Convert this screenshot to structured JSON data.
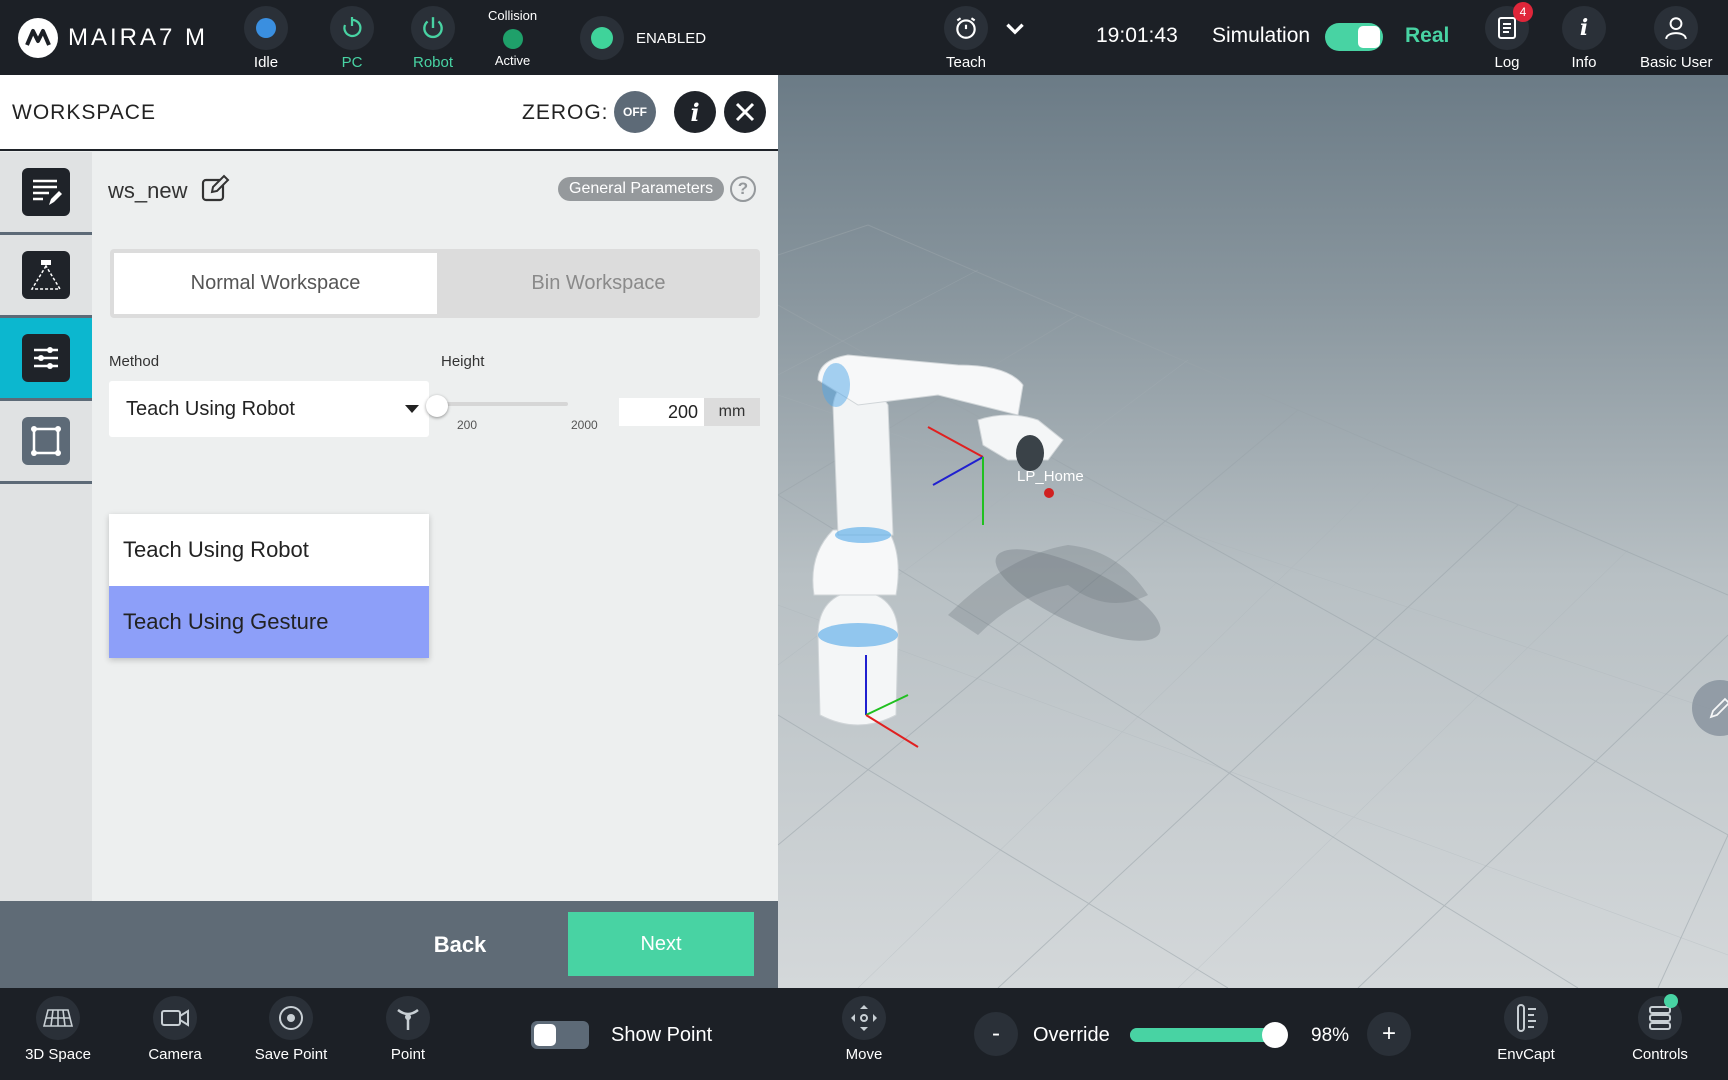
{
  "topbar": {
    "logo": "MAIRA7 M",
    "state_idle": "Idle",
    "state_pc": "PC",
    "state_robot": "Robot",
    "collision_title": "Collision",
    "collision_state": "Active",
    "enabled": "ENABLED",
    "teach": "Teach",
    "time": "19:01:43",
    "simulation": "Simulation",
    "real": "Real",
    "log": "Log",
    "log_badge": "4",
    "info": "Info",
    "user": "Basic User"
  },
  "panel": {
    "title": "WORKSPACE",
    "zerog": "ZEROG:",
    "zerog_state": "OFF",
    "ws_name": "ws_new",
    "general_params": "General Parameters",
    "help": "?",
    "tabs": [
      "Normal Workspace",
      "Bin Workspace"
    ],
    "method_label": "Method",
    "method_value": "Teach Using Robot",
    "method_options": [
      "Teach Using Robot",
      "Teach Using Gesture"
    ],
    "height_label": "Height",
    "height_min": "200",
    "height_max": "2000",
    "height_value": "200",
    "height_unit": "mm",
    "back": "Back",
    "next": "Next"
  },
  "view3d": {
    "point_label": "LP_Home"
  },
  "bottombar": {
    "items": [
      "3D Space",
      "Camera",
      "Save Point",
      "Point"
    ],
    "show_point": "Show Point",
    "move": "Move",
    "override_minus": "-",
    "override": "Override",
    "override_value": "98%",
    "override_fraction": 0.98,
    "override_plus": "+",
    "envcapt": "EnvCapt",
    "controls": "Controls"
  },
  "colors": {
    "accent_green": "#48d3a3",
    "accent_cyan": "#0cb7cf",
    "dropdown_highlight": "#8d9ff9",
    "topbar_bg": "#1c2026"
  }
}
